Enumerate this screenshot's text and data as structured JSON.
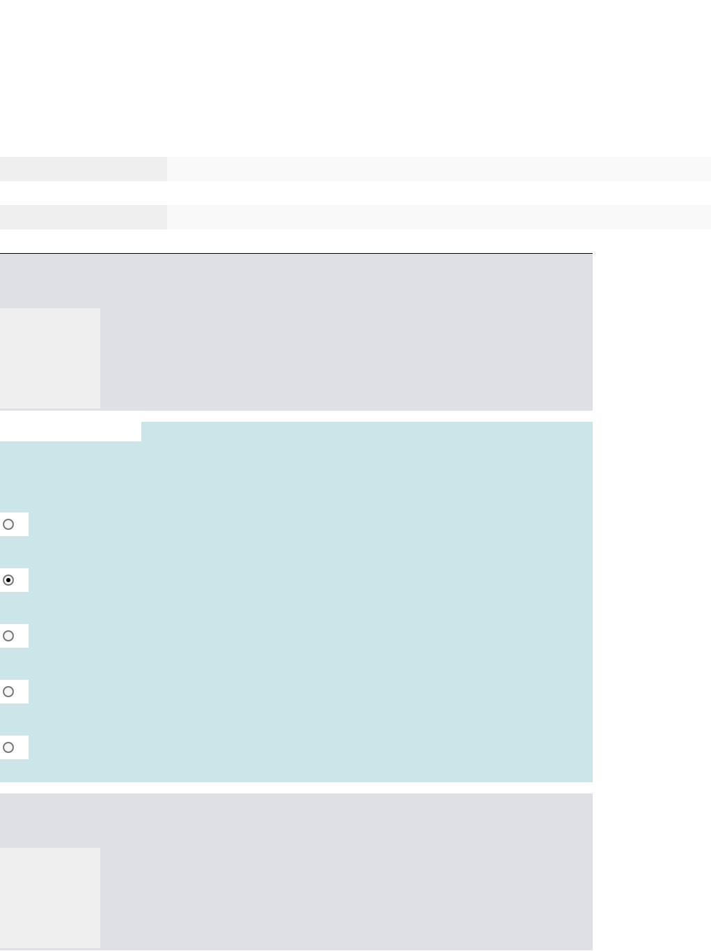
{
  "form_rows": [
    {
      "kind": "blank"
    },
    {
      "kind": "blank"
    }
  ],
  "panels": [
    {
      "kind": "slot"
    },
    {
      "kind": "choices",
      "options": [
        {
          "selected": false
        },
        {
          "selected": true
        },
        {
          "selected": false
        },
        {
          "selected": false
        },
        {
          "selected": false
        }
      ]
    },
    {
      "kind": "slot"
    }
  ]
}
